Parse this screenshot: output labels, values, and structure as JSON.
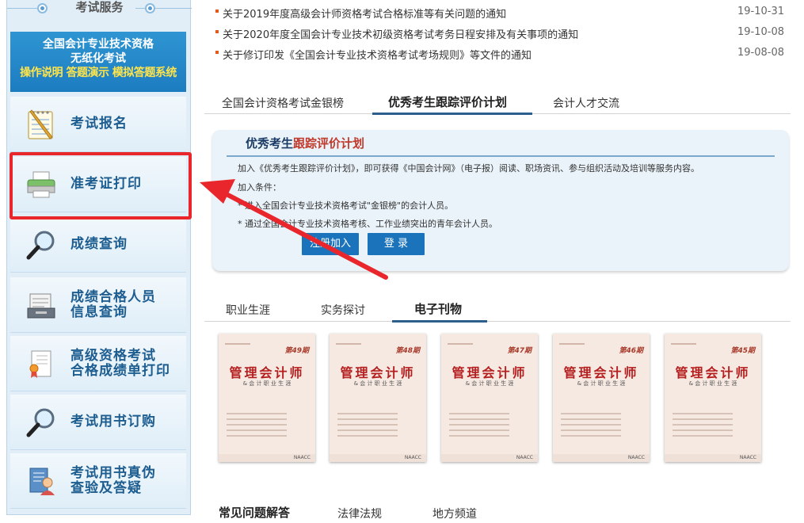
{
  "sidebar": {
    "title": "考试服务",
    "banner": {
      "line1": "全国会计专业技术资格",
      "line2": "无纸化考试",
      "line3": "操作说明 答题演示 模拟答题系统"
    },
    "items": [
      {
        "label": "考试报名",
        "icon": "notepad-icon"
      },
      {
        "label": "准考证打印",
        "icon": "printer-icon"
      },
      {
        "label": "成绩查询",
        "icon": "magnifier-icon"
      },
      {
        "label": "成绩合格人员信息查询",
        "line1": "成绩合格人员",
        "line2": "信息查询",
        "icon": "file-tray-icon"
      },
      {
        "label": "高级资格考试合格成绩单打印",
        "line1": "高级资格考试",
        "line2": "合格成绩单打印",
        "icon": "certificate-icon"
      },
      {
        "label": "考试用书订购",
        "icon": "magnifier-icon"
      },
      {
        "label": "考试用书真伪查验及答疑",
        "line1": "考试用书真伪",
        "line2": "查验及答疑",
        "icon": "book-person-icon"
      }
    ]
  },
  "news": [
    {
      "title": "关于2019年度高级会计师资格考试合格标准等有关问题的通知",
      "date": "19-10-31"
    },
    {
      "title": "关于2020年度全国会计专业技术初级资格考试考务日程安排及有关事项的通知",
      "date": "19-10-08"
    },
    {
      "title": "关于修订印发《全国会计专业技术资格考试考场规则》等文件的通知",
      "date": "19-08-08"
    }
  ],
  "tabs1": [
    "全国会计资格考试金银榜",
    "优秀考生跟踪评价计划",
    "会计人才交流"
  ],
  "card": {
    "title_a": "优秀考生",
    "title_b": "跟踪评价计划",
    "line1": "加入《优秀考生跟踪评价计划》，即可获得《中国会计网》（电子报）阅读、职场资讯、参与组织活动及培训等服务内容。",
    "line2": "加入条件：",
    "line3": "* 进入全国会计专业技术资格考试\"金银榜\"的会计人员。",
    "line4": "* 通过全国会计专业技术资格考核、工作业绩突出的青年会计人员。",
    "btn_join": "注册加入",
    "btn_login": "登 录"
  },
  "tabs2": [
    "职业生涯",
    "实务探讨",
    "电子刊物"
  ],
  "magazines": [
    {
      "issue": "第49期",
      "title": "管理会计师",
      "subtitle": "& 会 计 职 业 生 涯",
      "publisher": "NAACC"
    },
    {
      "issue": "第48期",
      "title": "管理会计师",
      "subtitle": "& 会 计 职 业 生 涯",
      "publisher": "NAACC"
    },
    {
      "issue": "第47期",
      "title": "管理会计师",
      "subtitle": "& 会 计 职 业 生 涯",
      "publisher": "NAACC"
    },
    {
      "issue": "第46期",
      "title": "管理会计师",
      "subtitle": "& 会 计 职 业 生 涯",
      "publisher": "NAACC"
    },
    {
      "issue": "第45期",
      "title": "管理会计师",
      "subtitle": "& 会 计 职 业 生 涯",
      "publisher": "NAACC"
    }
  ],
  "tabs3": [
    "常见问题解答",
    "法律法规",
    "地方频道"
  ],
  "colors": {
    "accent": "#1b73bb",
    "highlight": "#e8262c",
    "sidebar_bg": "#e2eef7"
  }
}
